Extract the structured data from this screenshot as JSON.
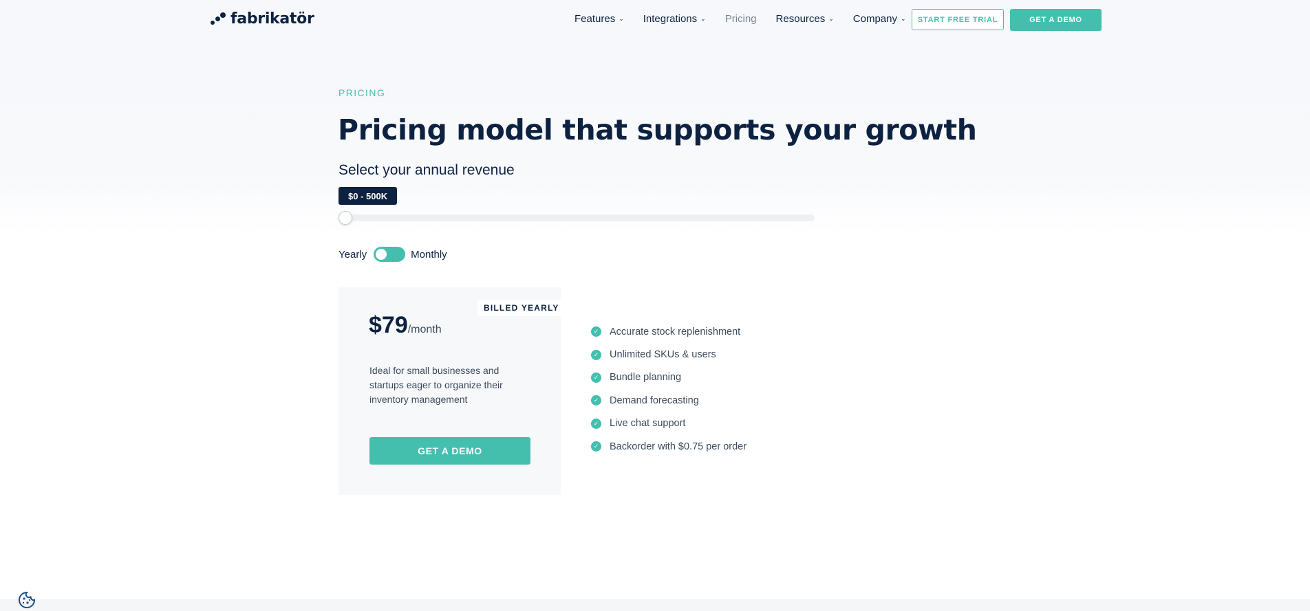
{
  "brand": {
    "name": "fabrikatör"
  },
  "nav": {
    "items": [
      {
        "label": "Features",
        "dropdown": true
      },
      {
        "label": "Integrations",
        "dropdown": true
      },
      {
        "label": "Pricing",
        "dropdown": false
      },
      {
        "label": "Resources",
        "dropdown": true
      },
      {
        "label": "Company",
        "dropdown": true
      }
    ],
    "trial_label": "START FREE TRIAL",
    "demo_label": "GET A DEMO"
  },
  "hero": {
    "eyebrow": "PRICING",
    "title": "Pricing model that supports your growth",
    "revenue_label": "Select your annual revenue",
    "revenue_value": "$0 - 500K",
    "slider_fraction": 0
  },
  "billing": {
    "yearly_label": "Yearly",
    "monthly_label": "Monthly",
    "selected": "Yearly"
  },
  "plan": {
    "badge": "BILLED YEARLY",
    "price": "$79",
    "period": "/month",
    "description": "Ideal for small businesses and startups eager to organize their inventory management",
    "cta_label": "GET A DEMO"
  },
  "features": [
    "Accurate stock replenishment",
    "Unlimited SKUs & users",
    "Bundle planning",
    "Demand forecasting",
    "Live chat support",
    "Backorder with $0.75 per order"
  ],
  "colors": {
    "accent": "#44bfae",
    "navy": "#0d2240"
  }
}
